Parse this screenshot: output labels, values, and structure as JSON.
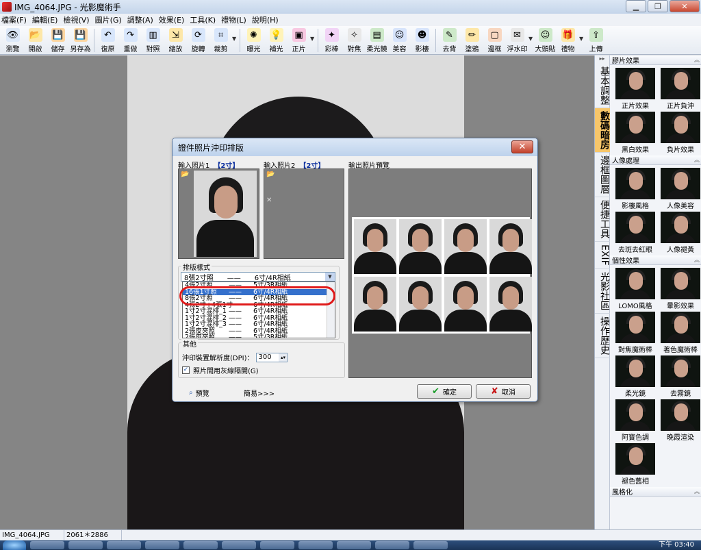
{
  "window": {
    "title": "IMG_4064.JPG - 光影魔術手",
    "minimize": "▁",
    "maximize": "❐",
    "close": "✕"
  },
  "menu": [
    "檔案(F)",
    "編輯(E)",
    "檢視(V)",
    "圖片(G)",
    "調整(A)",
    "效果(E)",
    "工具(K)",
    "禮物(L)",
    "說明(H)"
  ],
  "toolbar": {
    "items": [
      {
        "label": "瀏覽",
        "icon": "👁",
        "color": "#dce8f8"
      },
      {
        "label": "開啟",
        "icon": "📂",
        "color": "#fde7a8"
      },
      {
        "label": "儲存",
        "icon": "💾",
        "color": "#fcd5a0"
      },
      {
        "label": "另存為",
        "icon": "💾",
        "color": "#fcd5a0"
      },
      {
        "label": "復原",
        "icon": "↶",
        "color": "#d8e6fb"
      },
      {
        "label": "重做",
        "icon": "↷",
        "color": "#d8e6fb"
      },
      {
        "label": "對照",
        "icon": "▥",
        "color": "#d8e6fb"
      },
      {
        "label": "縮放",
        "icon": "⇲",
        "color": "#fde7a8"
      },
      {
        "label": "旋轉",
        "icon": "⟳",
        "color": "#d8e6fb"
      },
      {
        "label": "裁剪",
        "icon": "⌗",
        "color": "#d8e6fb"
      },
      {
        "label": "曝光",
        "icon": "✺",
        "color": "#fff3b8"
      },
      {
        "label": "補光",
        "icon": "💡",
        "color": "#fff3b8"
      },
      {
        "label": "正片",
        "icon": "▣",
        "color": "#f8c9e2"
      },
      {
        "label": "彩棒",
        "icon": "✦",
        "color": "#f1d4f6"
      },
      {
        "label": "對焦",
        "icon": "✧",
        "color": "#e8e8e8"
      },
      {
        "label": "柔光鏡",
        "icon": "▤",
        "color": "#cde9c9"
      },
      {
        "label": "美容",
        "icon": "☺",
        "color": "#d7e4fb"
      },
      {
        "label": "影樓",
        "icon": "☻",
        "color": "#d7e4fb"
      },
      {
        "label": "去背",
        "icon": "✎",
        "color": "#cde9c9"
      },
      {
        "label": "塗鴉",
        "icon": "✏",
        "color": "#fde7a8"
      },
      {
        "label": "邊框",
        "icon": "▢",
        "color": "#f8d7c1"
      },
      {
        "label": "浮水印",
        "icon": "✉",
        "color": "#e8e8e8"
      },
      {
        "label": "大頭貼",
        "icon": "☺",
        "color": "#cde9c9"
      },
      {
        "label": "禮物",
        "icon": "🎁",
        "color": "#fde7a8"
      },
      {
        "label": "上傳",
        "icon": "⇧",
        "color": "#cde9c9"
      }
    ]
  },
  "canvas": {
    "bg_color": "#858585"
  },
  "right_panel": {
    "tabs": [
      "基本調整",
      "數碼暗房",
      "邊框圖層",
      "便捷工具",
      "EXIF",
      "光影社區",
      "操作歷史"
    ],
    "active_tab": 1,
    "scroll_label": "▸▸",
    "sections": [
      {
        "title": "膠片效果",
        "items": [
          "正片效果",
          "正片負沖",
          "黑白效果",
          "負片效果"
        ]
      },
      {
        "title": "人像處理",
        "items": [
          "影樓風格",
          "人像美容",
          "去斑去紅眼",
          "人像褪黃"
        ]
      },
      {
        "title": "個性效果",
        "items": [
          "LOMO風格",
          "暈影效果",
          "對焦魔術棒",
          "著色魔術棒",
          "柔光鏡",
          "去霧鏡",
          "阿寶色調",
          "晚霞渲染",
          "褪色舊相"
        ]
      },
      {
        "title": "風格化",
        "items": []
      }
    ],
    "collapse_icon": "︽"
  },
  "dialog": {
    "title": "證件照片沖印排版",
    "close": "✕",
    "input1_label": "輸入照片1",
    "input1_size": "【2寸】",
    "input2_label": "輸入照片2",
    "input2_size": "【2寸】",
    "output_label": "輸出照片預覽",
    "folder_icon": "📂",
    "clear_icon": "✕",
    "layout_group": "排版樣式",
    "selected_value": "8張2寸照　　——　　6寸/4R相紙",
    "options": [
      {
        "name": "4張2寸照",
        "paper": "5寸/3R相紙"
      },
      {
        "name": "16張1寸照",
        "paper": "6寸/4R相紙"
      },
      {
        "name": "8張2寸照",
        "paper": "6寸/4R相紙"
      },
      {
        "name": "4張2寸+4張1寸",
        "paper": "6寸/4R相紙"
      },
      {
        "name": "1寸2寸混排_1",
        "paper": "6寸/4R相紙"
      },
      {
        "name": "1寸2寸混排_2",
        "paper": "6寸/4R相紙"
      },
      {
        "name": "1寸2寸混排_3",
        "paper": "6寸/4R相紙"
      },
      {
        "name": "2張皮夾照",
        "paper": "6寸/4R相紙"
      },
      {
        "name": "2張皮夾照",
        "paper": "5寸/3R相紙"
      }
    ],
    "option_dash": "——",
    "other_group": "其他",
    "dpi_label": "沖印裝置解析度(DPI)：",
    "dpi_value": "300",
    "gray_line_label": "照片間用灰線隔開(G)",
    "gray_line_checked": "✓",
    "preview_button": "預覽",
    "simple_button": "簡易>>>",
    "ok_button": "確定",
    "cancel_button": "取消"
  },
  "status": {
    "filename": "IMG_4064.JPG",
    "dimensions": "2061＊2886"
  },
  "taskbar": {
    "clock": "下午 03:40"
  }
}
